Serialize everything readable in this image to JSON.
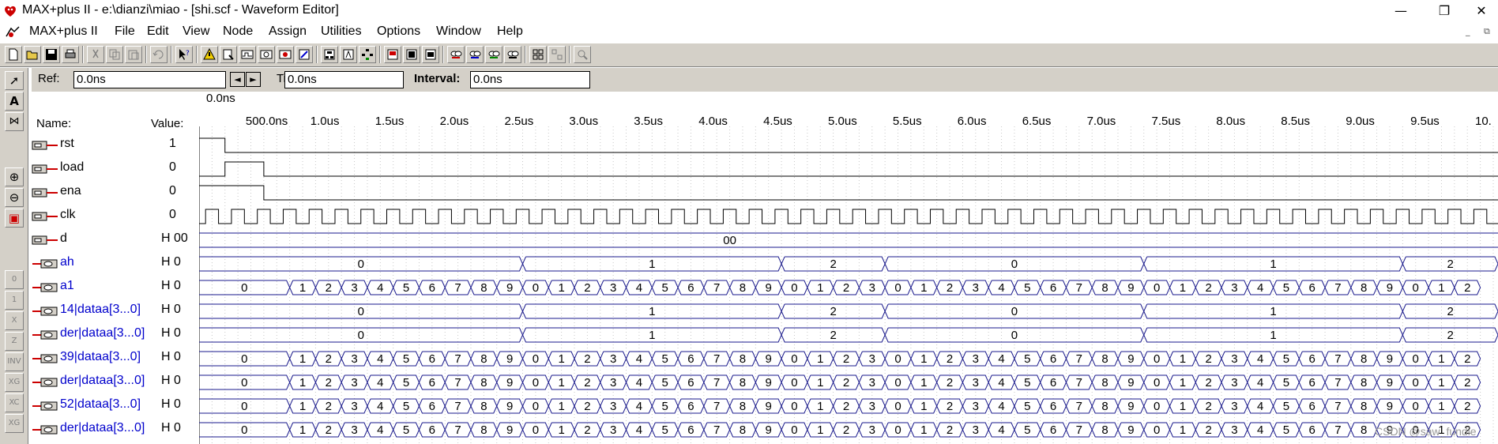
{
  "window": {
    "title": "MAX+plus II - e:\\dianzi\\miao - [shi.scf - Waveform Editor]",
    "minimize_glyph": "—",
    "maximize_glyph": "❐",
    "close_glyph": "✕"
  },
  "menu": {
    "app_label": "MAX+plus II",
    "items": [
      "File",
      "Edit",
      "View",
      "Node",
      "Assign",
      "Utilities",
      "Options",
      "Window",
      "Help"
    ],
    "mdi_minimize": "_",
    "mdi_restore": "⧉"
  },
  "toolbar": {
    "icons": [
      "new-icon",
      "open-icon",
      "save-icon",
      "print-icon",
      "cut-icon",
      "copy-icon",
      "paste-icon",
      "undo-icon",
      "help-pointer-icon",
      "warning-icon",
      "compiler-icon",
      "simulator-icon",
      "timing-analyzer-icon",
      "programmer-icon",
      "floorplan-icon",
      "hierarchy-icon",
      "project-icon",
      "graphic-editor-icon",
      "symbol-editor-icon",
      "text-editor-icon",
      "waveform-editor-icon",
      "find-icon",
      "find-next-icon",
      "find-prev-icon",
      "search-node-icon",
      "tile-icon",
      "cascade-icon",
      "zoom-icon"
    ]
  },
  "refbar": {
    "ref_label": "Ref:",
    "ref_value": "0.0ns",
    "time_label": "Time:",
    "time_value": "0.0ns",
    "interval_label": "Interval:",
    "interval_value": "0.0ns",
    "left_arrow": "◄",
    "right_arrow": "►"
  },
  "editor": {
    "name_header": "Name:",
    "value_header": "Value:",
    "cursor_time": "0.0ns",
    "time_ticks": [
      "500.0ns",
      "1.0us",
      "1.5us",
      "2.0us",
      "2.5us",
      "3.0us",
      "3.5us",
      "4.0us",
      "4.5us",
      "5.0us",
      "5.5us",
      "6.0us",
      "6.5us",
      "7.0us",
      "7.5us",
      "8.0us",
      "8.5us",
      "9.0us",
      "9.5us",
      "10."
    ],
    "watermark": "CSDN @saw_fundie"
  },
  "left_tools": [
    "select-tool",
    "text-tool",
    "zoom-fit-tool",
    "zoom-in-tool",
    "zoom-out-tool",
    "fit-window-tool",
    "force-0-tool",
    "force-1-tool",
    "force-x-tool",
    "force-z-tool",
    "invert-tool",
    "overwrite-count-tool",
    "overwrite-clock-tool",
    "overwrite-group-tool"
  ],
  "signals": [
    {
      "name": "rst",
      "value": "1",
      "type": "in"
    },
    {
      "name": "load",
      "value": "0",
      "type": "in"
    },
    {
      "name": "ena",
      "value": "0",
      "type": "in"
    },
    {
      "name": "clk",
      "value": "0",
      "type": "in"
    },
    {
      "name": "d",
      "value": "H 00",
      "type": "in"
    },
    {
      "name": "ah",
      "value": "H 0",
      "type": "out"
    },
    {
      "name": "a1",
      "value": "H 0",
      "type": "out"
    },
    {
      "name": "14|dataa[3...0]",
      "value": "H 0",
      "type": "out"
    },
    {
      "name": "der|dataa[3...0]",
      "value": "H 0",
      "type": "out"
    },
    {
      "name": "39|dataa[3...0]",
      "value": "H 0",
      "type": "out"
    },
    {
      "name": "der|dataa[3...0]",
      "value": "H 0",
      "type": "out"
    },
    {
      "name": "52|dataa[3...0]",
      "value": "H 0",
      "type": "out"
    },
    {
      "name": "der|dataa[3...0]",
      "value": "H 0",
      "type": "out"
    }
  ],
  "waves": {
    "d_label": "00",
    "ah_segments": [
      {
        "t0": 0,
        "t1": 2.5,
        "label": "0"
      },
      {
        "t0": 2.5,
        "t1": 4.5,
        "label": "1"
      },
      {
        "t0": 4.5,
        "t1": 5.3,
        "label": "2"
      },
      {
        "t0": 5.3,
        "t1": 7.3,
        "label": "0"
      },
      {
        "t0": 7.3,
        "t1": 9.3,
        "label": "1"
      },
      {
        "t0": 9.3,
        "t1": 10.5,
        "label": "2"
      }
    ],
    "a1_first_label": "0",
    "a1_digits": [
      "1",
      "2",
      "3",
      "4",
      "5",
      "6",
      "7",
      "8",
      "9",
      "0",
      "1",
      "2",
      "3",
      "4",
      "5",
      "6",
      "7",
      "8",
      "9",
      "0",
      "1",
      "2",
      "3",
      "0",
      "1",
      "2",
      "3",
      "4",
      "5",
      "6",
      "7",
      "8",
      "9",
      "0",
      "1",
      "2",
      "3",
      "4",
      "5",
      "6",
      "7",
      "8",
      "9",
      "0",
      "1",
      "2"
    ],
    "clk_period_us": 0.2
  }
}
